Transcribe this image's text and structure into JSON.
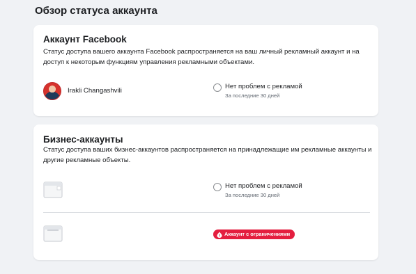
{
  "page": {
    "title": "Обзор статуса аккаунта"
  },
  "facebook_section": {
    "title": "Аккаунт Facebook",
    "description": "Статус доступа вашего аккаунта Facebook распространяется на ваш личный рекламный аккаунт и на доступ к некоторым функциям управления рекламными объектами.",
    "user_name": "Irakli Changashvili",
    "status_label": "Нет проблем с рекламой",
    "status_period": "За последние 30 дней"
  },
  "business_section": {
    "title": "Бизнес-аккаунты",
    "description": "Статус доступа ваших бизнес-аккаунтов распространяется на принадлежащие им рекламные аккаунты и другие рекламные объекты.",
    "accounts": [
      {
        "status_label": "Нет проблем с рекламой",
        "status_period": "За последние 30 дней"
      },
      {
        "badge_label": "Аккаунт с ограничениями",
        "badge_color": "#e41e3f"
      }
    ]
  },
  "colors": {
    "page_bg": "#f0f2f5",
    "card_bg": "#ffffff",
    "danger": "#e41e3f"
  }
}
